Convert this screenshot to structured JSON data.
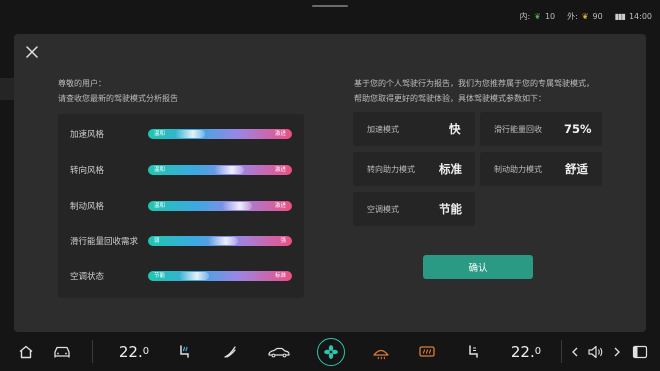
{
  "status": {
    "inside_label": "内:",
    "inside_value": "10",
    "outside_label": "外:",
    "outside_value": "90",
    "time": "14:00"
  },
  "intro": {
    "line1": "尊敬的用户：",
    "line2": "请查收您最新的驾驶模式分析报告"
  },
  "styles": [
    {
      "label": "加速风格",
      "left": "温和",
      "right": "激进",
      "level": 0.29
    },
    {
      "label": "转向风格",
      "left": "温和",
      "right": "激进",
      "level": 0.56
    },
    {
      "label": "制动风格",
      "left": "温和",
      "right": "激进",
      "level": 0.62
    },
    {
      "label": "滑行能量回收需求",
      "left": "弱",
      "right": "强",
      "level": 0.52
    },
    {
      "label": "空调状态",
      "left": "节能",
      "right": "标准",
      "level": 0.32
    }
  ],
  "recommendation": {
    "line1": "基于您的个人驾驶行为报告，我们为您推荐属于您的专属驾驶模式，",
    "line2": "帮助您取得更好的驾驶体验，具体驾驶模式参数如下："
  },
  "params": [
    {
      "label": "加速模式",
      "value": "快"
    },
    {
      "label": "滑行能量回收",
      "value": "75%"
    },
    {
      "label": "转向助力模式",
      "value": "标准"
    },
    {
      "label": "制动助力模式",
      "value": "舒适"
    },
    {
      "label": "空调模式",
      "value": "节能"
    }
  ],
  "confirm_label": "确认",
  "dock": {
    "left_temp": "22.",
    "left_temp_dec": "0",
    "right_temp": "22.",
    "right_temp_dec": "0"
  },
  "colors": {
    "accent": "#2fc4b0",
    "confirm": "#2a9a84",
    "gradient_start": "#1fc7b0",
    "gradient_mid": "#9a86e6",
    "gradient_end": "#ee4f84"
  }
}
